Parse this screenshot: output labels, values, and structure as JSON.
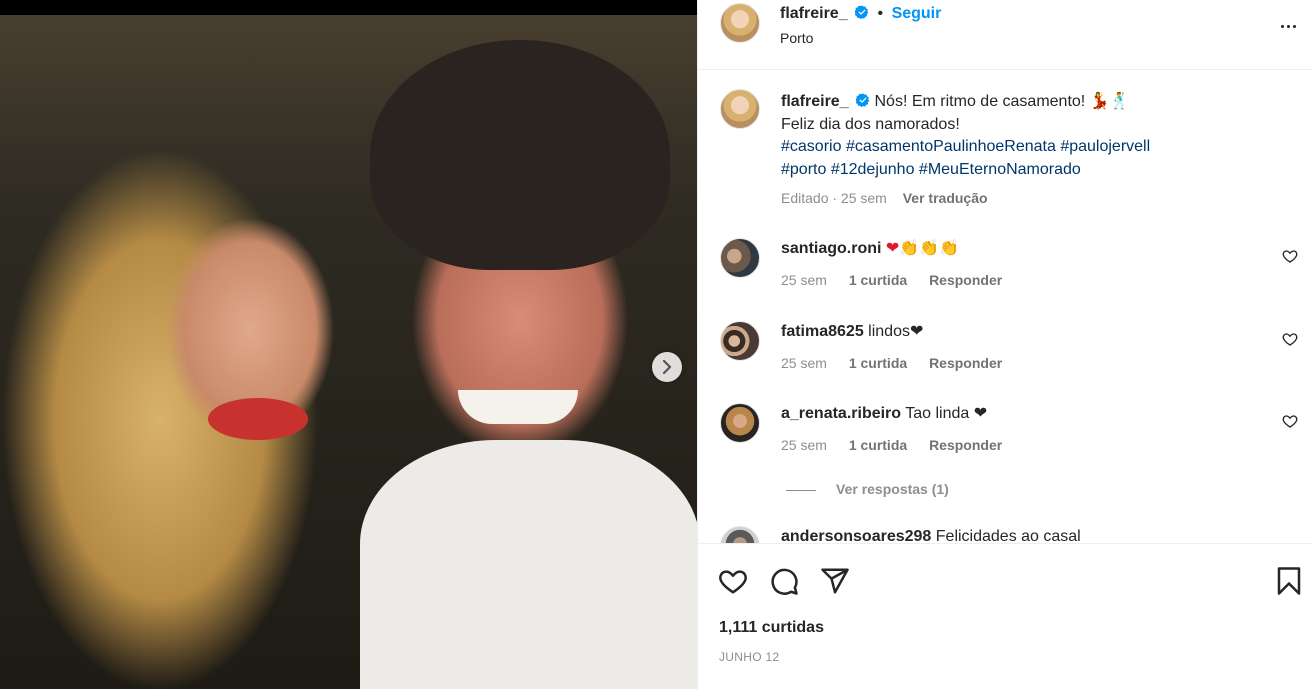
{
  "post": {
    "author": "flafreire_",
    "follow_label": "Seguir",
    "separator": "•",
    "location": "Porto",
    "caption_text": "Nós! Em ritmo de casamento! 💃🕺 Feliz dia dos namorados!",
    "hashtags": [
      "#casorio",
      "#casamentoPaulinhoeRenata",
      "#paulojervell",
      "#porto",
      "#12dejunho",
      "#MeuEternoNamorado"
    ],
    "caption_meta": "Editado · 25 sem",
    "translate_label": "Ver tradução"
  },
  "comments": [
    {
      "user": "santiago.roni",
      "text": "❤👏👏👏",
      "time": "25 sem",
      "likes": "1 curtida",
      "reply": "Responder"
    },
    {
      "user": "fatima8625",
      "text": "lindos❤",
      "time": "25 sem",
      "likes": "1 curtida",
      "reply": "Responder"
    },
    {
      "user": "a_renata.ribeiro",
      "text": "Tao linda ❤",
      "time": "25 sem",
      "likes": "1 curtida",
      "reply": "Responder"
    },
    {
      "user": "andersonsoares298",
      "text": "Felicidades ao casal",
      "time": "",
      "likes": "",
      "reply": ""
    }
  ],
  "view_replies_label": "Ver respostas (1)",
  "footer": {
    "likes_count": "1,111 curtidas",
    "date": "JUNHO 12"
  },
  "colors": {
    "link_blue": "#0095f6",
    "hashtag": "#00376b",
    "muted": "#8e8e8e",
    "heart": "#e0192f",
    "verified": "#0095f6"
  },
  "icons": [
    "verified-badge-icon",
    "more-options-icon",
    "carousel-next-icon",
    "heart-icon",
    "comment-icon",
    "share-icon",
    "bookmark-icon"
  ]
}
